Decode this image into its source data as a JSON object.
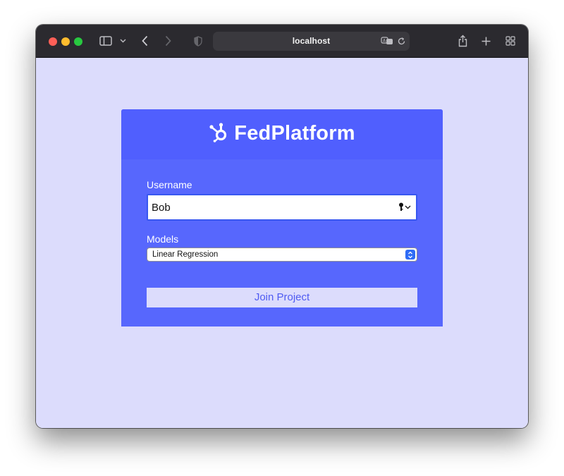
{
  "browser": {
    "url": "localhost",
    "traffic_lights": {
      "close": "#fe5f57",
      "minimize": "#febc2e",
      "zoom": "#28c840"
    },
    "icons": [
      "sidebar-icon",
      "chevron-down-icon",
      "back-icon",
      "forward-icon",
      "privacy-shield-icon",
      "translate-icon",
      "reload-icon",
      "share-icon",
      "new-tab-icon",
      "tab-overview-icon"
    ]
  },
  "page": {
    "background": "#dcdcfc",
    "card": {
      "brand_name": "FedPlatform",
      "brand_icon": "hubspot-sprocket-icon",
      "username_label": "Username",
      "username_value": "Bob",
      "models_label": "Models",
      "models_selected": "Linear Regression",
      "join_label": "Join Project",
      "accent": "#505ffe",
      "body_color": "#5767fd"
    }
  }
}
